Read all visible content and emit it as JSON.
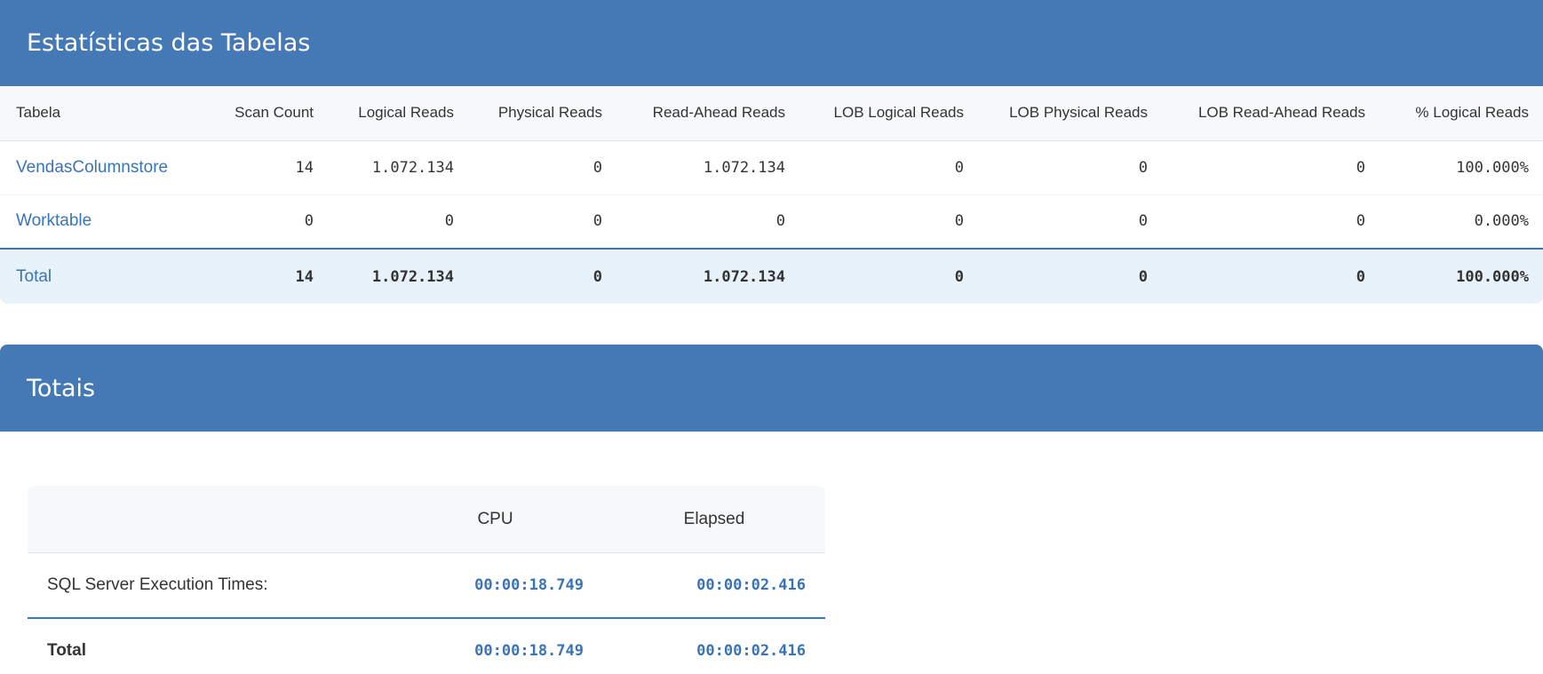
{
  "stats": {
    "title": "Estatísticas das Tabelas",
    "columns": [
      "Tabela",
      "Scan Count",
      "Logical Reads",
      "Physical Reads",
      "Read-Ahead Reads",
      "LOB Logical Reads",
      "LOB Physical Reads",
      "LOB Read-Ahead Reads",
      "% Logical Reads"
    ],
    "rows": [
      [
        "VendasColumnstore",
        "14",
        "1.072.134",
        "0",
        "1.072.134",
        "0",
        "0",
        "0",
        "100.000%"
      ],
      [
        "Worktable",
        "0",
        "0",
        "0",
        "0",
        "0",
        "0",
        "0",
        "0.000%"
      ]
    ],
    "total": [
      "Total",
      "14",
      "1.072.134",
      "0",
      "1.072.134",
      "0",
      "0",
      "0",
      "100.000%"
    ]
  },
  "totals": {
    "title": "Totais",
    "columns": [
      "",
      "CPU",
      "Elapsed"
    ],
    "rows": [
      [
        "SQL Server Execution Times:",
        "00:00:18.749",
        "00:00:02.416"
      ]
    ],
    "total": [
      "Total",
      "00:00:18.749",
      "00:00:02.416"
    ]
  }
}
